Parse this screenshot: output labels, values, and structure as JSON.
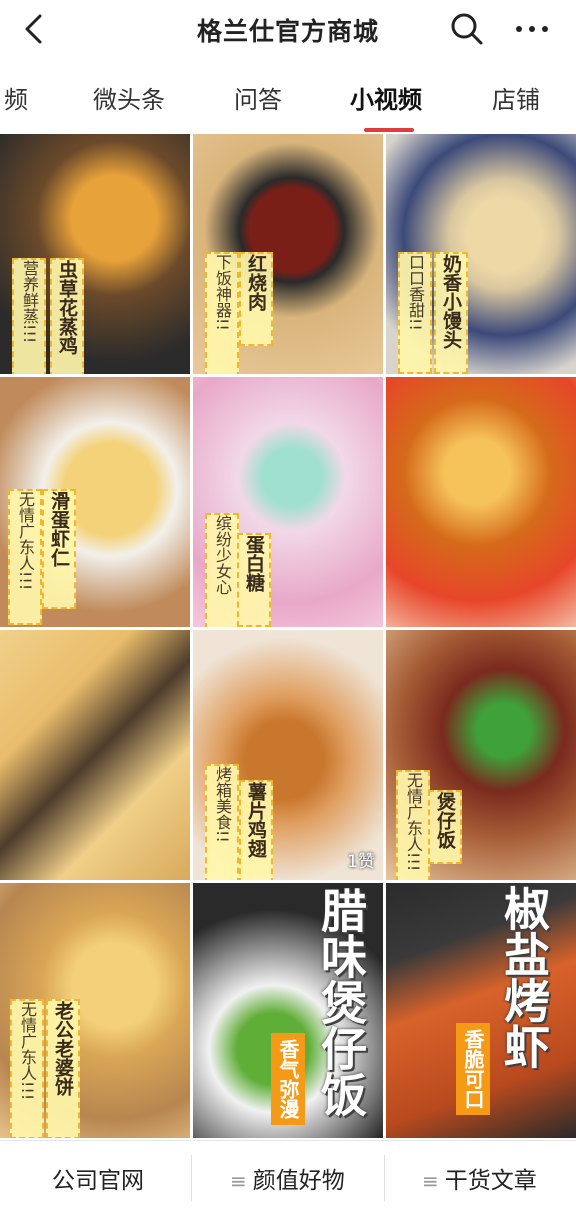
{
  "header": {
    "title": "格兰仕官方商城",
    "back_icon": "chevron-left-icon",
    "search_icon": "search-icon",
    "more_icon": "more-dots-icon"
  },
  "tabs": [
    {
      "label": "频"
    },
    {
      "label": "微头条"
    },
    {
      "label": "问答"
    },
    {
      "label": "小视频",
      "active": true
    },
    {
      "label": "店铺"
    }
  ],
  "accent_color": "#e03c3c",
  "videos": [
    {
      "title": "虫草花蒸鸡",
      "subtitle": "营养鲜蒸",
      "dots": "!!!"
    },
    {
      "title": "红烧肉",
      "subtitle": "下饭神器",
      "dots": "!!"
    },
    {
      "title": "奶香小馒头",
      "subtitle": "口口香甜",
      "dots": "!!"
    },
    {
      "title": "滑蛋虾仁",
      "subtitle": "无情广东人",
      "dots": "!!!"
    },
    {
      "title": "蛋白糖",
      "subtitle": "缤纷少女心",
      "dots": ""
    },
    {
      "title": "",
      "subtitle": "",
      "dots": ""
    },
    {
      "title": "",
      "subtitle": "",
      "dots": ""
    },
    {
      "title": "薯片鸡翅",
      "subtitle": "烤箱美食",
      "dots": "!!",
      "likes": "1赞"
    },
    {
      "title": "煲仔饭",
      "subtitle": "无情广东人",
      "dots": "!!!"
    },
    {
      "title": "老公老婆饼",
      "subtitle": "无情广东人",
      "dots": "!!!"
    },
    {
      "title": "腊味煲仔饭",
      "tag": "香气弥漫"
    },
    {
      "title": "椒盐烤虾",
      "tag": "香脆可口"
    }
  ],
  "bottom_bar": {
    "items": [
      {
        "label": "公司官网"
      },
      {
        "label": "颜值好物",
        "icon": "menu-lines-icon"
      },
      {
        "label": "干货文章",
        "icon": "menu-lines-icon"
      }
    ]
  }
}
